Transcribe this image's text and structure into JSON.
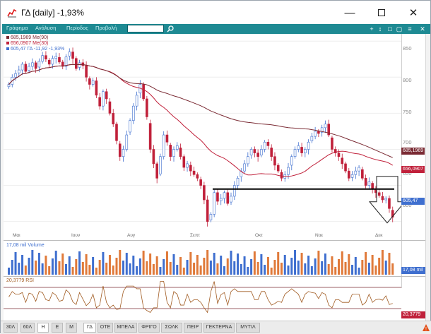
{
  "window": {
    "title": "ΓΔ [daily] -1,93%"
  },
  "toolbar": {
    "menus": [
      "Γράφημα",
      "Ανάλυση",
      "Περίοδος",
      "Προβολή"
    ],
    "search_value": "",
    "icons": [
      "plus-icon",
      "crosshair-icon",
      "square-icon",
      "window-icon",
      "close-icon"
    ]
  },
  "legend": {
    "ma90": "685,1969 Me(90)",
    "ma30": "656,0907 Me(30)",
    "price": "605,47 ΓΔ -11,92 -1,93%"
  },
  "price_axis": {
    "ticks": [
      "850",
      "800",
      "750",
      "700",
      "650",
      "600"
    ],
    "tag_ma90": "685,1969",
    "tag_ma30": "656,0907",
    "tag_price": "605,47"
  },
  "x_axis": {
    "labels": [
      "Μαι",
      "Ιουν",
      "Αυγ",
      "Σεπτ",
      "Οκτ",
      "Νοε",
      "Δεκ"
    ]
  },
  "volume": {
    "label": "17,08 mil Volume",
    "tag": "17,08 mil"
  },
  "rsi": {
    "label": "20,3779 RSI",
    "tag": "20,3779"
  },
  "tabs": {
    "periods": [
      "30Λ",
      "60Λ",
      "H",
      "E",
      "M"
    ],
    "symbols": [
      "ΓΔ",
      "ΟΤΕ",
      "ΜΠΕΛΑ",
      "ΦΡΙΓΟ",
      "ΣΩΛΚ",
      "ΠΕΙΡ",
      "ΓΕΚΤΕΡΝΑ",
      "ΜΥΤΙΛ"
    ]
  },
  "colors": {
    "up": "#3f6fcf",
    "down": "#c0203a",
    "ma30": "#c0203a",
    "ma90": "#7a2a33",
    "teal": "#1e8a93",
    "rsi": "#a05a20"
  },
  "chart_data": {
    "type": "candlestick",
    "title": "ΓΔ [daily] -1,93%",
    "ylim": [
      585,
      860
    ],
    "series": [
      {
        "name": "ΓΔ",
        "last": 605.47
      },
      {
        "name": "Me(30)",
        "last": 656.0907
      },
      {
        "name": "Me(90)",
        "last": 685.1969
      }
    ],
    "closes": [
      790,
      800,
      805,
      810,
      818,
      808,
      815,
      820,
      812,
      822,
      830,
      825,
      818,
      826,
      829,
      821,
      815,
      828,
      835,
      826,
      812,
      820,
      816,
      800,
      790,
      795,
      775,
      760,
      780,
      770,
      750,
      735,
      712,
      690,
      700,
      720,
      740,
      760,
      775,
      790,
      770,
      745,
      700,
      680,
      660,
      690,
      720,
      710,
      690,
      700,
      705,
      690,
      675,
      680,
      670,
      665,
      660,
      650,
      630,
      600,
      610,
      640,
      628,
      632,
      640,
      625,
      635,
      650,
      660,
      670,
      680,
      690,
      700,
      695,
      690,
      700,
      710,
      705,
      690,
      678,
      670,
      660,
      665,
      675,
      690,
      700,
      705,
      695,
      700,
      710,
      718,
      725,
      722,
      730,
      735,
      720,
      700,
      695,
      690,
      680,
      670,
      660,
      665,
      670,
      675,
      660,
      650,
      655,
      645,
      640,
      636,
      630,
      632,
      618,
      606
    ],
    "annotations": {
      "support_line": 645,
      "breakdown_arrow": "down"
    }
  }
}
